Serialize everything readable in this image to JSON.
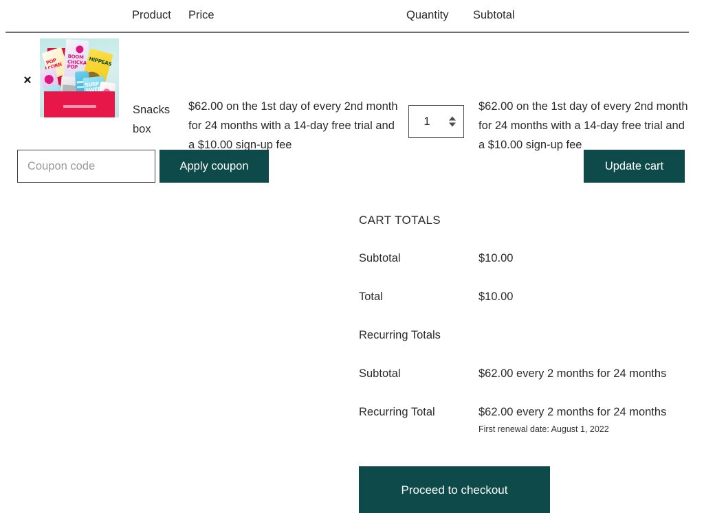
{
  "cart_table": {
    "columns": {
      "remove": "×",
      "product": "Product",
      "price": "Price",
      "quantity": "Quantity",
      "subtotal": "Subtotal"
    },
    "rows": [
      {
        "remove_label": "×",
        "thumbnail_alt": "Snacks box product photo",
        "product_name": "Snacks box",
        "price": "$62.00 on the 1st day of every 2nd month for 24 months with a 14-day free trial and a $10.00 sign-up fee",
        "quantity_value": "1",
        "subtotal": "$62.00 on the 1st day of every 2nd month for 24 months with a 14-day free trial and a $10.00 sign-up fee"
      }
    ]
  },
  "actions": {
    "coupon_placeholder": "Coupon code",
    "coupon_value": "",
    "apply_coupon_label": "Apply coupon",
    "update_cart_label": "Update cart"
  },
  "cart_totals": {
    "title": "CART TOTALS",
    "rows": [
      {
        "label": "Subtotal",
        "value": "$10.00"
      },
      {
        "label": "Total",
        "value": "$10.00"
      },
      {
        "label": "Recurring Totals",
        "value": ""
      },
      {
        "label": "Subtotal",
        "value": "$62.00 every 2 months for 24 months"
      },
      {
        "label": "Recurring Total",
        "value": "$62.00 every 2 months for 24 months",
        "note": "First renewal date: August 1, 2022"
      }
    ]
  },
  "checkout": {
    "label": "Proceed to checkout"
  },
  "colors": {
    "button_bg": "#0e4a49",
    "button_text": "#ffffff",
    "text": "#2b2b2b",
    "header_rule": "#6c7076",
    "placeholder": "#9a9a9a"
  }
}
